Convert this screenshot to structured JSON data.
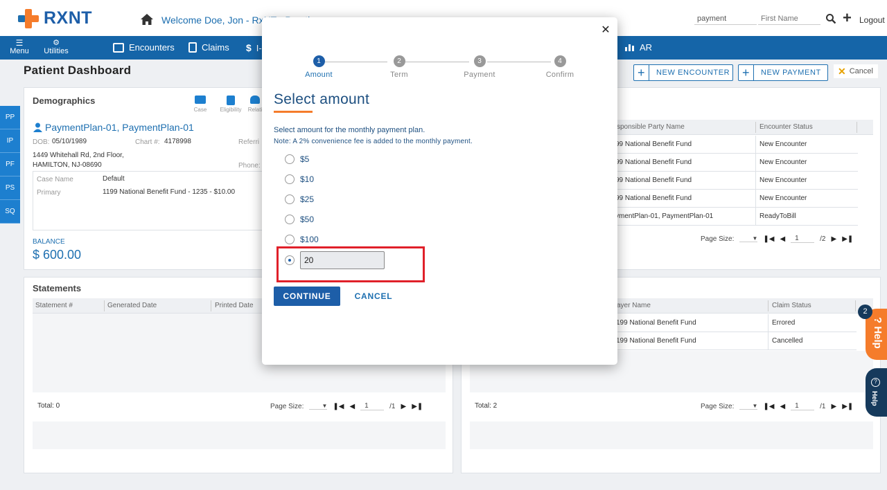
{
  "header": {
    "logo_text": "RXNT",
    "welcome": "Welcome  Doe, Jon - RxNT - Practice",
    "search1_value": "payment",
    "search2_placeholder": "First Name",
    "logout": "Logout"
  },
  "nav": {
    "menu": "Menu",
    "utilities": "Utilities",
    "items": [
      "Encounters",
      "Claims",
      "I-",
      "AR"
    ]
  },
  "page": {
    "title": "Patient Dashboard",
    "new_encounter": "NEW ENCOUNTER",
    "new_payment": "NEW PAYMENT",
    "cancel": "Cancel"
  },
  "side_tabs": [
    "PP",
    "IP",
    "PF",
    "PS",
    "SQ"
  ],
  "demographics": {
    "title": "Demographics",
    "icons": [
      "Case",
      "Eligibility",
      "Relati"
    ],
    "patient_name": "PaymentPlan-01, PaymentPlan-01",
    "dob_label": "DOB:",
    "dob": "05/10/1989",
    "chart_label": "Chart #:",
    "chart": "4178998",
    "referring_label": "Referri",
    "phone_label": "Phone:",
    "address1": "1449 Whitehall Rd, 2nd Floor,",
    "address2": "HAMILTON, NJ-08690",
    "case_name_label": "Case Name",
    "case_name": "Default",
    "primary_label": "Primary",
    "primary": "1199 National Benefit Fund - 1235 - $10.00",
    "balance_label": "BALANCE",
    "balance": "$ 600.00"
  },
  "encounters_table": {
    "headers": [
      "sponsible Party Name",
      "Encounter Status"
    ],
    "rows": [
      [
        "99 National Benefit Fund",
        "New Encounter"
      ],
      [
        "99 National Benefit Fund",
        "New Encounter"
      ],
      [
        "99 National Benefit Fund",
        "New Encounter"
      ],
      [
        "99 National Benefit Fund",
        "New Encounter"
      ],
      [
        "ymentPlan-01, PaymentPlan-01",
        "ReadyToBill"
      ]
    ],
    "page_size_label": "Page Size:",
    "page": "1",
    "total_pages": "/2"
  },
  "statements": {
    "title": "Statements",
    "headers": [
      "Statement #",
      "Generated Date",
      "Printed Date"
    ],
    "total": "Total: 0",
    "page_size_label": "Page Size:",
    "page": "1",
    "total_pages": "/1"
  },
  "claims_table": {
    "headers": [
      "ayer Name",
      "Claim Status"
    ],
    "rows": [
      [
        "199 National Benefit Fund",
        "Errored"
      ],
      [
        "199 National Benefit Fund",
        "Cancelled"
      ]
    ],
    "total": "Total: 2",
    "page_size_label": "Page Size:",
    "page": "1",
    "total_pages": "/1"
  },
  "dialog": {
    "steps": [
      {
        "num": "1",
        "label": "Amount"
      },
      {
        "num": "2",
        "label": "Term"
      },
      {
        "num": "3",
        "label": "Payment"
      },
      {
        "num": "4",
        "label": "Confirm"
      }
    ],
    "title": "Select amount",
    "description": "Select amount for the monthly payment plan.",
    "note": "Note: A 2% convenience fee is added to the monthly payment.",
    "options": [
      "$5",
      "$10",
      "$25",
      "$50",
      "$100"
    ],
    "custom_value": "20",
    "continue_label": "CONTINUE",
    "cancel_label": "CANCEL"
  },
  "help": {
    "orange_label": "? Help",
    "badge": "2",
    "dark_label": "Help"
  },
  "colors": {
    "brand_blue": "#1565a8",
    "accent_orange": "#f57c2b",
    "highlight_red": "#e0202a"
  }
}
